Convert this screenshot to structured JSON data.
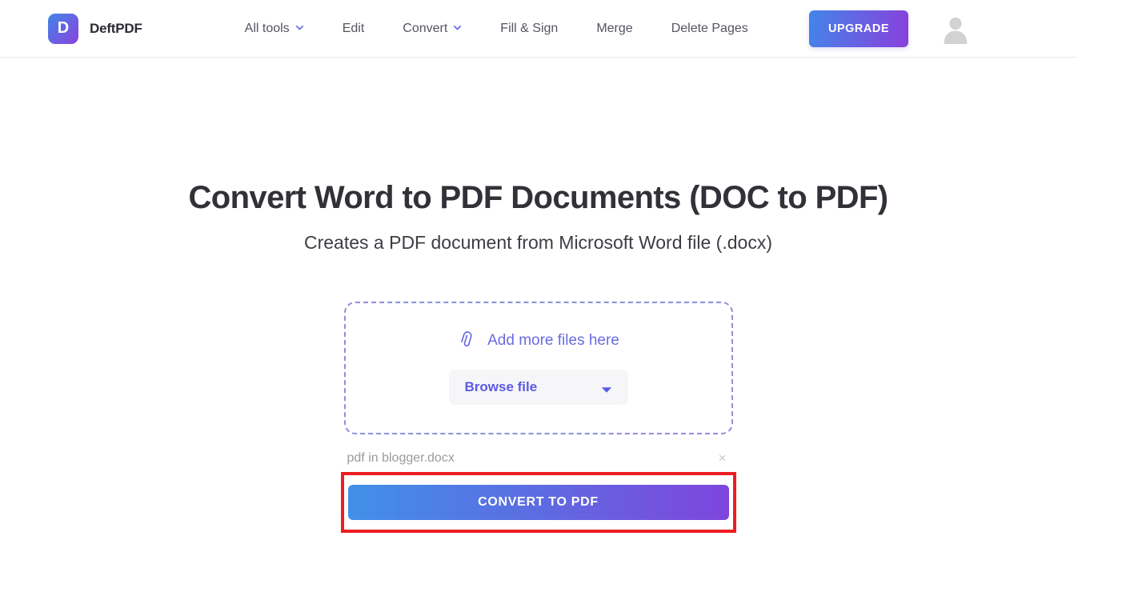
{
  "header": {
    "brand": {
      "logo_letter": "D",
      "name": "DeftPDF"
    },
    "nav": [
      {
        "label": "All tools",
        "has_dropdown": true
      },
      {
        "label": "Edit",
        "has_dropdown": false
      },
      {
        "label": "Convert",
        "has_dropdown": true
      },
      {
        "label": "Fill & Sign",
        "has_dropdown": false
      },
      {
        "label": "Merge",
        "has_dropdown": false
      },
      {
        "label": "Delete Pages",
        "has_dropdown": false
      }
    ],
    "upgrade_label": "UPGRADE",
    "avatar_icon": "user-avatar-icon"
  },
  "main": {
    "title": "Convert Word to PDF Documents (DOC to PDF)",
    "subtitle": "Creates a PDF document from Microsoft Word file (.docx)"
  },
  "dropzone": {
    "paperclip_icon": "paperclip-icon",
    "add_files_label": "Add more files here",
    "browse_label": "Browse file",
    "caret_icon": "caret-down-icon"
  },
  "file": {
    "name": "pdf in blogger.docx",
    "remove_icon": "×"
  },
  "convert": {
    "label": "CONVERT TO PDF"
  },
  "colors": {
    "brand_gradient_start": "#4285e8",
    "brand_gradient_end": "#8a42de",
    "accent_purple": "#6a6ce2",
    "browse_text": "#5a5ae6",
    "convert_gradient_start": "#4190e8",
    "convert_gradient_end": "#7f45dd",
    "highlight_red": "#ee1c23",
    "nav_text": "#55555f",
    "title_text": "#313138",
    "file_name_text": "#9b9b9f"
  }
}
